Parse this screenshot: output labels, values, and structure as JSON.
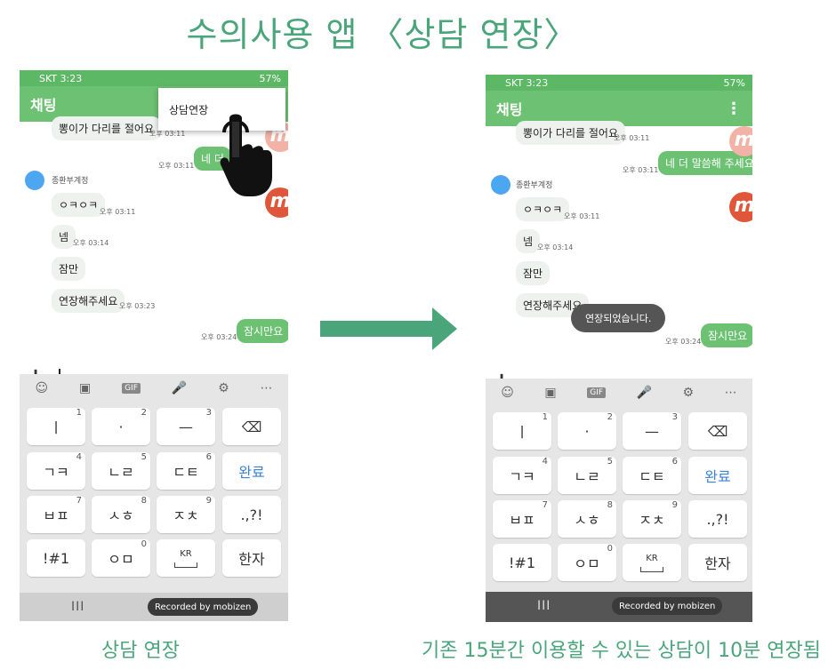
{
  "title": "수의사용 앱 〈상담 연장〉",
  "caption_left": "상담 연장",
  "caption_right": "기존 15분간 이용할 수 있는 상담이 10분 연장됨",
  "status": {
    "left": "SKT 3:23",
    "right": "57%"
  },
  "appbar_title": "채팅",
  "menu_item": "상담연장",
  "sender_name": "종환부계정",
  "messages": {
    "top_in": "뽕이가 다리를 절어요",
    "top_in_time": "오후 03:11",
    "out1": "네 더 말씀해 주세요",
    "out1_visible": "네 더",
    "out1_time": "오후 03:11",
    "in1": "ㅇㅋㅇㅋ",
    "in1_time": "오후 03:11",
    "in2": "넴",
    "in2_time": "오후 03:14",
    "in3": "잠만",
    "in4": "연장해주세요",
    "in4_time": "오후 03:23",
    "out2": "잠시만요",
    "out2_time": "오후 03:24"
  },
  "toast": "연장되었습니다.",
  "keyboard": {
    "keys": [
      {
        "label": "ㅣ",
        "num": "1"
      },
      {
        "label": "·",
        "num": "2"
      },
      {
        "label": "—",
        "num": "3"
      },
      {
        "label": "⌫",
        "num": ""
      },
      {
        "label": "ㄱㅋ",
        "num": "4"
      },
      {
        "label": "ㄴㄹ",
        "num": "5"
      },
      {
        "label": "ㄷㅌ",
        "num": "6"
      },
      {
        "label": "완료",
        "num": ""
      },
      {
        "label": "ㅂㅍ",
        "num": "7"
      },
      {
        "label": "ㅅㅎ",
        "num": "8"
      },
      {
        "label": "ㅈㅊ",
        "num": "9"
      },
      {
        "label": ".,?!",
        "num": ""
      },
      {
        "label": "!#1",
        "num": ""
      },
      {
        "label": "ㅇㅁ",
        "num": "0"
      },
      {
        "label": "KR",
        "num": ""
      },
      {
        "label": "한자",
        "num": ""
      }
    ],
    "tools": [
      "☺",
      "▣",
      "GIF",
      "🎤",
      "⚙",
      "⋯"
    ]
  },
  "recorded_by": "Recorded by mobizen",
  "nav_lines": "III",
  "colors": {
    "accent": "#4aa67a",
    "green_bar": "#6cc172",
    "badge": "#e0563a"
  }
}
